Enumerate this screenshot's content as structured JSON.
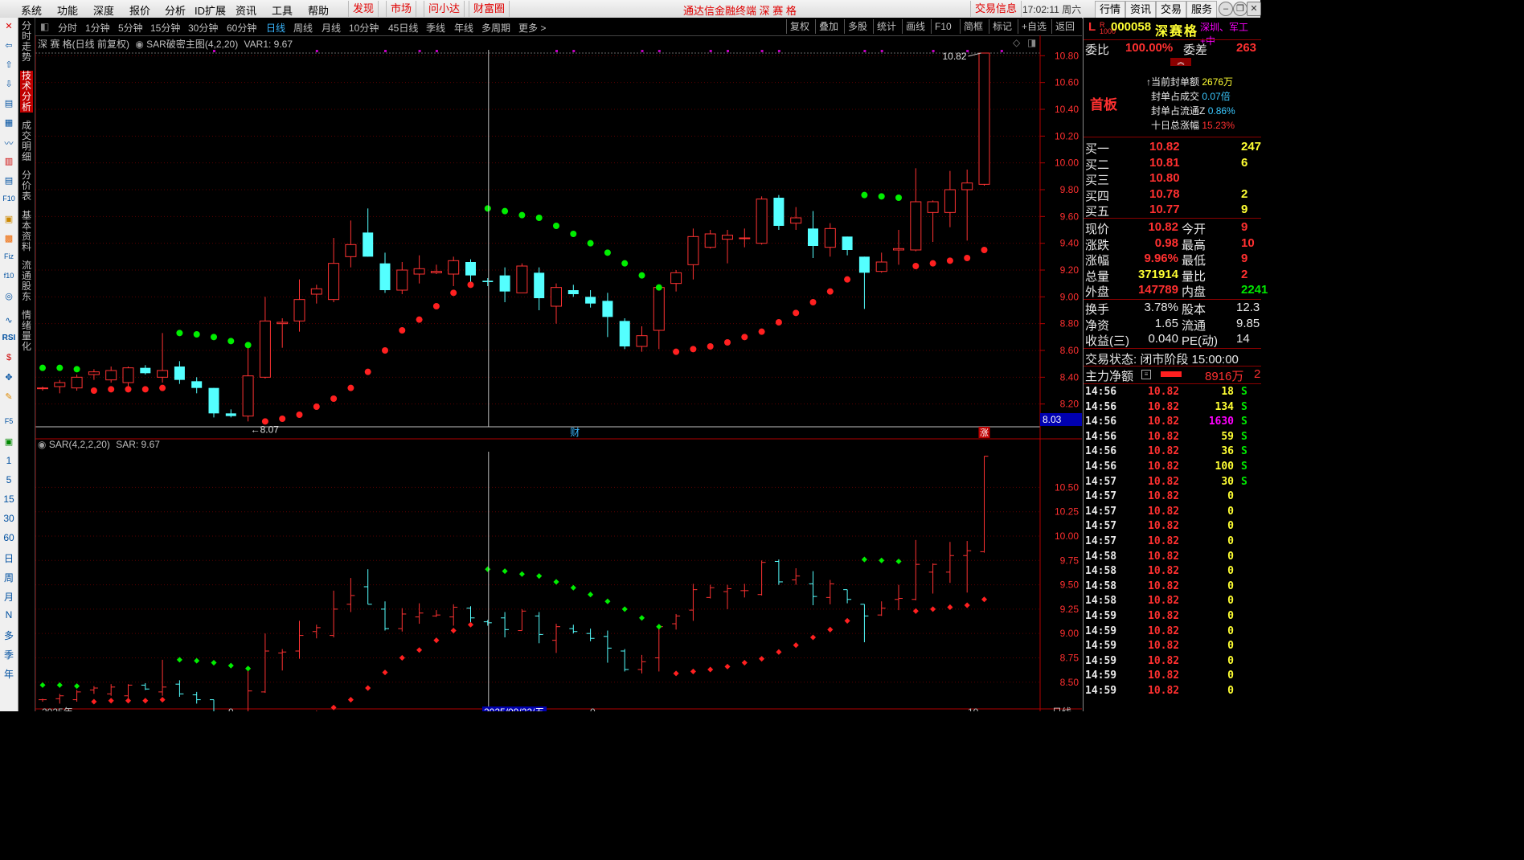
{
  "menu": {
    "items": [
      "系统",
      "功能",
      "深度",
      "报价",
      "分析",
      "ID扩展",
      "资讯",
      "工具",
      "帮助"
    ],
    "highlights": [
      "发现",
      "市场",
      "问小达",
      "财富圈"
    ],
    "title": "通达信金融终端  深 赛 格",
    "trade_info": "交易信息",
    "clock": "17:02:11 周六",
    "right_buttons": [
      "行情",
      "资讯",
      "交易",
      "服务"
    ]
  },
  "left_toolbar": {
    "icons": [
      "close-icon",
      "arrow-left-icon",
      "arrow-up-icon",
      "arrow-down-icon",
      "report-icon",
      "grid-icon",
      "line-chart-icon",
      "candle-icon",
      "table-icon",
      "f10-icon",
      "tile-icon",
      "book-icon",
      "fiz-icon",
      "f10b-icon",
      "circle-icon",
      "wave-icon",
      "rsi-icon",
      "s-icon",
      "move-icon",
      "pen-icon",
      "f5-icon",
      "img-icon"
    ],
    "labels": [
      "RSI",
      "1",
      "5",
      "15",
      "30",
      "60",
      "日",
      "周",
      "月",
      "N",
      "多",
      "季",
      "年"
    ]
  },
  "vertical_tabs": [
    "分时走势",
    "技术分析",
    "成交明细",
    "分价表",
    "基本资料",
    "流通股东",
    "情绪量化"
  ],
  "period_bar": {
    "periods": [
      "分时",
      "1分钟",
      "5分钟",
      "15分钟",
      "30分钟",
      "60分钟",
      "日线",
      "周线",
      "月线",
      "10分钟",
      "45日线",
      "季线",
      "年线",
      "多周期",
      "更多 >"
    ],
    "active": "日线",
    "right_tools": [
      "复权",
      "叠加",
      "多股",
      "统计",
      "画线",
      "F10",
      "简框",
      "标记",
      "+自选",
      "返回"
    ]
  },
  "main_chart": {
    "info": {
      "stock": "深 赛 格(日线 前复权)",
      "indicator": "SAR破密主图(4,2,20)",
      "var1": "VAR1: 9.67"
    },
    "yticks": [
      "10.80",
      "10.60",
      "10.40",
      "10.20",
      "10.00",
      "9.80",
      "9.60",
      "9.40",
      "9.20",
      "9.00",
      "8.80",
      "8.60",
      "8.40",
      "8.20"
    ],
    "high_label": "10.82",
    "low_label": "8.07",
    "cursor_price": "8.03",
    "marker_cai": "财",
    "marker_zhang": "涨"
  },
  "sub_chart": {
    "info": {
      "indicator": "SAR(4,2,2,20)",
      "value": "SAR: 9.67"
    },
    "yticks": [
      "10.50",
      "10.25",
      "10.00",
      "9.75",
      "9.50",
      "9.25",
      "9.00",
      "8.75",
      "8.50"
    ],
    "bottom_labels": [
      "2025年",
      "9",
      "2025/09/22/五",
      "0",
      "10",
      "日线"
    ]
  },
  "chart_data": {
    "type": "candlestick",
    "title": "深 赛 格(日线 前复权)",
    "ylim": [
      8.03,
      10.82
    ],
    "candles": [
      {
        "o": 8.32,
        "h": 8.33,
        "l": 8.3,
        "c": 8.32
      },
      {
        "o": 8.33,
        "h": 8.38,
        "l": 8.28,
        "c": 8.36
      },
      {
        "o": 8.32,
        "h": 8.42,
        "l": 8.3,
        "c": 8.4
      },
      {
        "o": 8.42,
        "h": 8.46,
        "l": 8.38,
        "c": 8.44
      },
      {
        "o": 8.38,
        "h": 8.48,
        "l": 8.36,
        "c": 8.45
      },
      {
        "o": 8.36,
        "h": 8.48,
        "l": 8.33,
        "c": 8.47
      },
      {
        "o": 8.47,
        "h": 8.49,
        "l": 8.42,
        "c": 8.43
      },
      {
        "o": 8.4,
        "h": 8.73,
        "l": 8.36,
        "c": 8.45
      },
      {
        "o": 8.48,
        "h": 8.52,
        "l": 8.35,
        "c": 8.38
      },
      {
        "o": 8.37,
        "h": 8.4,
        "l": 8.28,
        "c": 8.32
      },
      {
        "o": 8.32,
        "h": 8.32,
        "l": 8.1,
        "c": 8.13
      },
      {
        "o": 8.13,
        "h": 8.16,
        "l": 8.1,
        "c": 8.11
      },
      {
        "o": 8.11,
        "h": 8.62,
        "l": 8.07,
        "c": 8.41
      },
      {
        "o": 8.4,
        "h": 9.0,
        "l": 8.39,
        "c": 8.82
      },
      {
        "o": 8.8,
        "h": 8.84,
        "l": 8.62,
        "c": 8.81
      },
      {
        "o": 8.82,
        "h": 9.13,
        "l": 8.74,
        "c": 8.98
      },
      {
        "o": 9.02,
        "h": 9.09,
        "l": 8.95,
        "c": 9.06
      },
      {
        "o": 8.98,
        "h": 9.44,
        "l": 8.96,
        "c": 9.25
      },
      {
        "o": 9.3,
        "h": 9.57,
        "l": 9.22,
        "c": 9.39
      },
      {
        "o": 9.48,
        "h": 9.66,
        "l": 9.3,
        "c": 9.3
      },
      {
        "o": 9.25,
        "h": 9.33,
        "l": 9.03,
        "c": 9.05
      },
      {
        "o": 9.05,
        "h": 9.26,
        "l": 9.02,
        "c": 9.2
      },
      {
        "o": 9.17,
        "h": 9.31,
        "l": 9.1,
        "c": 9.21
      },
      {
        "o": 9.18,
        "h": 9.24,
        "l": 9.17,
        "c": 9.19
      },
      {
        "o": 9.17,
        "h": 9.3,
        "l": 9.08,
        "c": 9.27
      },
      {
        "o": 9.26,
        "h": 9.28,
        "l": 9.1,
        "c": 9.16
      },
      {
        "o": 9.12,
        "h": 9.14,
        "l": 9.08,
        "c": 9.11
      },
      {
        "o": 9.16,
        "h": 9.22,
        "l": 8.96,
        "c": 9.04
      },
      {
        "o": 9.03,
        "h": 9.25,
        "l": 9.03,
        "c": 9.23
      },
      {
        "o": 9.18,
        "h": 9.22,
        "l": 8.9,
        "c": 8.99
      },
      {
        "o": 8.93,
        "h": 9.1,
        "l": 8.8,
        "c": 9.07
      },
      {
        "o": 9.05,
        "h": 9.09,
        "l": 9.0,
        "c": 9.02
      },
      {
        "o": 9.0,
        "h": 9.05,
        "l": 8.92,
        "c": 8.95
      },
      {
        "o": 8.97,
        "h": 9.03,
        "l": 8.7,
        "c": 8.85
      },
      {
        "o": 8.82,
        "h": 8.84,
        "l": 8.61,
        "c": 8.63
      },
      {
        "o": 8.63,
        "h": 8.78,
        "l": 8.59,
        "c": 8.71
      },
      {
        "o": 8.75,
        "h": 9.08,
        "l": 8.61,
        "c": 9.07
      },
      {
        "o": 9.1,
        "h": 9.2,
        "l": 9.04,
        "c": 9.18
      },
      {
        "o": 9.24,
        "h": 9.51,
        "l": 9.13,
        "c": 9.45
      },
      {
        "o": 9.37,
        "h": 9.5,
        "l": 9.36,
        "c": 9.47
      },
      {
        "o": 9.43,
        "h": 9.5,
        "l": 9.25,
        "c": 9.46
      },
      {
        "o": 9.44,
        "h": 9.51,
        "l": 9.37,
        "c": 9.44
      },
      {
        "o": 9.4,
        "h": 9.75,
        "l": 9.39,
        "c": 9.73
      },
      {
        "o": 9.74,
        "h": 9.76,
        "l": 9.5,
        "c": 9.53
      },
      {
        "o": 9.55,
        "h": 9.67,
        "l": 9.5,
        "c": 9.59
      },
      {
        "o": 9.51,
        "h": 9.64,
        "l": 9.29,
        "c": 9.38
      },
      {
        "o": 9.37,
        "h": 9.55,
        "l": 9.3,
        "c": 9.51
      },
      {
        "o": 9.45,
        "h": 9.45,
        "l": 9.31,
        "c": 9.35
      },
      {
        "o": 9.3,
        "h": 9.3,
        "l": 8.91,
        "c": 9.18
      },
      {
        "o": 9.19,
        "h": 9.33,
        "l": 9.18,
        "c": 9.26
      },
      {
        "o": 9.35,
        "h": 9.5,
        "l": 9.24,
        "c": 9.36
      },
      {
        "o": 9.35,
        "h": 9.96,
        "l": 9.34,
        "c": 9.71
      },
      {
        "o": 9.63,
        "h": 9.72,
        "l": 9.41,
        "c": 9.71
      },
      {
        "o": 9.63,
        "h": 9.94,
        "l": 9.52,
        "c": 9.8
      },
      {
        "o": 9.8,
        "h": 9.95,
        "l": 9.42,
        "c": 9.85
      },
      {
        "o": 9.84,
        "h": 10.82,
        "l": 9.83,
        "c": 10.82
      }
    ],
    "sar_above": [
      {
        "i": 0,
        "v": 8.47
      },
      {
        "i": 1,
        "v": 8.47
      },
      {
        "i": 2,
        "v": 8.46
      },
      {
        "i": 8,
        "v": 8.73
      },
      {
        "i": 9,
        "v": 8.72
      },
      {
        "i": 10,
        "v": 8.7
      },
      {
        "i": 11,
        "v": 8.67
      },
      {
        "i": 12,
        "v": 8.64
      },
      {
        "i": 26,
        "v": 9.66
      },
      {
        "i": 27,
        "v": 9.64
      },
      {
        "i": 28,
        "v": 9.61
      },
      {
        "i": 29,
        "v": 9.59
      },
      {
        "i": 30,
        "v": 9.53
      },
      {
        "i": 31,
        "v": 9.47
      },
      {
        "i": 32,
        "v": 9.4
      },
      {
        "i": 33,
        "v": 9.33
      },
      {
        "i": 34,
        "v": 9.25
      },
      {
        "i": 35,
        "v": 9.16
      },
      {
        "i": 36,
        "v": 9.07
      },
      {
        "i": 48,
        "v": 9.76
      },
      {
        "i": 49,
        "v": 9.75
      },
      {
        "i": 50,
        "v": 9.74
      }
    ],
    "sar_below": [
      {
        "i": 3,
        "v": 8.3
      },
      {
        "i": 4,
        "v": 8.31
      },
      {
        "i": 5,
        "v": 8.31
      },
      {
        "i": 6,
        "v": 8.31
      },
      {
        "i": 7,
        "v": 8.32
      },
      {
        "i": 13,
        "v": 8.07
      },
      {
        "i": 14,
        "v": 8.09
      },
      {
        "i": 15,
        "v": 8.12
      },
      {
        "i": 16,
        "v": 8.18
      },
      {
        "i": 17,
        "v": 8.24
      },
      {
        "i": 18,
        "v": 8.32
      },
      {
        "i": 19,
        "v": 8.44
      },
      {
        "i": 20,
        "v": 8.6
      },
      {
        "i": 21,
        "v": 8.75
      },
      {
        "i": 22,
        "v": 8.83
      },
      {
        "i": 23,
        "v": 8.93
      },
      {
        "i": 24,
        "v": 9.03
      },
      {
        "i": 25,
        "v": 9.09
      },
      {
        "i": 37,
        "v": 8.59
      },
      {
        "i": 38,
        "v": 8.61
      },
      {
        "i": 39,
        "v": 8.63
      },
      {
        "i": 40,
        "v": 8.66
      },
      {
        "i": 41,
        "v": 8.7
      },
      {
        "i": 42,
        "v": 8.74
      },
      {
        "i": 43,
        "v": 8.81
      },
      {
        "i": 44,
        "v": 8.88
      },
      {
        "i": 45,
        "v": 8.96
      },
      {
        "i": 46,
        "v": 9.04
      },
      {
        "i": 47,
        "v": 9.13
      },
      {
        "i": 51,
        "v": 9.23
      },
      {
        "i": 52,
        "v": 9.25
      },
      {
        "i": 53,
        "v": 9.27
      },
      {
        "i": 54,
        "v": 9.29
      },
      {
        "i": 55,
        "v": 9.35
      }
    ],
    "sub_ylim": [
      8.3,
      10.85
    ]
  },
  "right_panel": {
    "header": {
      "prefix": "L",
      "code": "000058",
      "name": "深赛格",
      "tags": "深圳、军工+中"
    },
    "weibi": {
      "label": "委比",
      "value": "100.00%",
      "diff_label": "委差",
      "diff_value": "263"
    },
    "shouban": "首板",
    "seal_info": [
      {
        "label": "↑当前封单额",
        "value": "2676万",
        "color": "yel"
      },
      {
        "label": "封单占成交",
        "value": "0.07倍",
        "color": "cyan"
      },
      {
        "label": "封单占流通Z",
        "value": "0.86%",
        "color": "cyan"
      },
      {
        "label": "十日总涨幅",
        "value": "15.23%",
        "color": "red"
      }
    ],
    "bids": [
      {
        "label": "买一",
        "price": "10.82",
        "vol": "247"
      },
      {
        "label": "买二",
        "price": "10.81",
        "vol": "6"
      },
      {
        "label": "买三",
        "price": "10.80",
        "vol": ""
      },
      {
        "label": "买四",
        "price": "10.78",
        "vol": "2"
      },
      {
        "label": "买五",
        "price": "10.77",
        "vol": "9"
      }
    ],
    "quote": [
      {
        "l1": "现价",
        "v1": "10.82",
        "c1": "red",
        "l2": "今开",
        "v2": "9",
        "c2": "red"
      },
      {
        "l1": "涨跌",
        "v1": "0.98",
        "c1": "red",
        "l2": "最高",
        "v2": "10",
        "c2": "red"
      },
      {
        "l1": "涨幅",
        "v1": "9.96%",
        "c1": "red",
        "l2": "最低",
        "v2": "9",
        "c2": "red"
      },
      {
        "l1": "总量",
        "v1": "371914",
        "c1": "yel",
        "l2": "量比",
        "v2": "2",
        "c2": "red"
      },
      {
        "l1": "外盘",
        "v1": "147789",
        "c1": "red",
        "l2": "内盘",
        "v2": "2241",
        "c2": "grn"
      }
    ],
    "fund": [
      {
        "l1": "换手",
        "v1": "3.78%",
        "l2": "股本",
        "v2": "12.3"
      },
      {
        "l1": "净资",
        "v1": "1.65",
        "l2": "流通",
        "v2": "9.85"
      },
      {
        "l1": "收益(三)",
        "v1": "0.040",
        "l2": "PE(动)",
        "v2": "14"
      }
    ],
    "status": "交易状态: 闭市阶段  15:00:00",
    "main_net": {
      "label": "主力净额",
      "value": "8916万",
      "suffix": "2"
    },
    "ticks": [
      {
        "t": "14:56",
        "p": "10.82",
        "v": "18",
        "vc": "yel",
        "s": "S"
      },
      {
        "t": "14:56",
        "p": "10.82",
        "v": "134",
        "vc": "yel",
        "s": "S"
      },
      {
        "t": "14:56",
        "p": "10.82",
        "v": "1630",
        "vc": "mag",
        "s": "S"
      },
      {
        "t": "14:56",
        "p": "10.82",
        "v": "59",
        "vc": "yel",
        "s": "S"
      },
      {
        "t": "14:56",
        "p": "10.82",
        "v": "36",
        "vc": "yel",
        "s": "S"
      },
      {
        "t": "14:56",
        "p": "10.82",
        "v": "100",
        "vc": "yel",
        "s": "S"
      },
      {
        "t": "14:57",
        "p": "10.82",
        "v": "30",
        "vc": "yel",
        "s": "S"
      },
      {
        "t": "14:57",
        "p": "10.82",
        "v": "0",
        "vc": "yel",
        "s": ""
      },
      {
        "t": "14:57",
        "p": "10.82",
        "v": "0",
        "vc": "yel",
        "s": ""
      },
      {
        "t": "14:57",
        "p": "10.82",
        "v": "0",
        "vc": "yel",
        "s": ""
      },
      {
        "t": "14:57",
        "p": "10.82",
        "v": "0",
        "vc": "yel",
        "s": ""
      },
      {
        "t": "14:58",
        "p": "10.82",
        "v": "0",
        "vc": "yel",
        "s": ""
      },
      {
        "t": "14:58",
        "p": "10.82",
        "v": "0",
        "vc": "yel",
        "s": ""
      },
      {
        "t": "14:58",
        "p": "10.82",
        "v": "0",
        "vc": "yel",
        "s": ""
      },
      {
        "t": "14:58",
        "p": "10.82",
        "v": "0",
        "vc": "yel",
        "s": ""
      },
      {
        "t": "14:59",
        "p": "10.82",
        "v": "0",
        "vc": "yel",
        "s": ""
      },
      {
        "t": "14:59",
        "p": "10.82",
        "v": "0",
        "vc": "yel",
        "s": ""
      },
      {
        "t": "14:59",
        "p": "10.82",
        "v": "0",
        "vc": "yel",
        "s": ""
      },
      {
        "t": "14:59",
        "p": "10.82",
        "v": "0",
        "vc": "yel",
        "s": ""
      },
      {
        "t": "14:59",
        "p": "10.82",
        "v": "0",
        "vc": "yel",
        "s": ""
      },
      {
        "t": "14:59",
        "p": "10.82",
        "v": "0",
        "vc": "yel",
        "s": ""
      }
    ]
  },
  "colors": {
    "up": "#ff3232",
    "down": "#54ffff",
    "sar_red": "#ff2020",
    "sar_green": "#00ee00",
    "grid": "#5a0000",
    "axis": "#b00000"
  }
}
